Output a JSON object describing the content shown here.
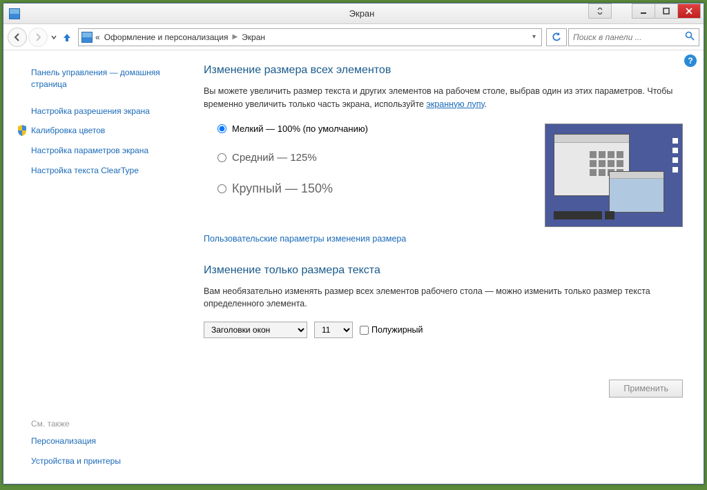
{
  "window": {
    "title": "Экран"
  },
  "breadcrumb": {
    "level1_prefix": "«",
    "level1": "Оформление и персонализация",
    "level2": "Экран"
  },
  "search": {
    "placeholder": "Поиск в панели ..."
  },
  "sidebar": {
    "home": "Панель управления — домашняя страница",
    "resolution": "Настройка разрешения экрана",
    "color_calibration": "Калибровка цветов",
    "display_settings": "Настройка параметров экрана",
    "cleartype": "Настройка текста ClearType",
    "see_also_label": "См. также",
    "personalization": "Персонализация",
    "devices_printers": "Устройства и принтеры"
  },
  "content": {
    "section1_title": "Изменение размера всех элементов",
    "section1_text_start": "Вы можете увеличить размер текста и других элементов на рабочем столе, выбрав один из этих параметров. Чтобы временно увеличить только часть экрана, используйте ",
    "magnifier_link": "экранную лупу",
    "period": ".",
    "radio_small": "Мелкий — 100% (по умолчанию)",
    "radio_medium": "Средний — 125%",
    "radio_large": "Крупный — 150%",
    "custom_sizing_link": "Пользовательские параметры изменения размера",
    "section2_title": "Изменение только размера текста",
    "section2_text": "Вам необязательно изменять размер всех элементов рабочего стола — можно изменить только размер текста определенного элемента.",
    "element_select_value": "Заголовки окон",
    "size_select_value": "11",
    "bold_label": "Полужирный",
    "apply_button": "Применить"
  }
}
